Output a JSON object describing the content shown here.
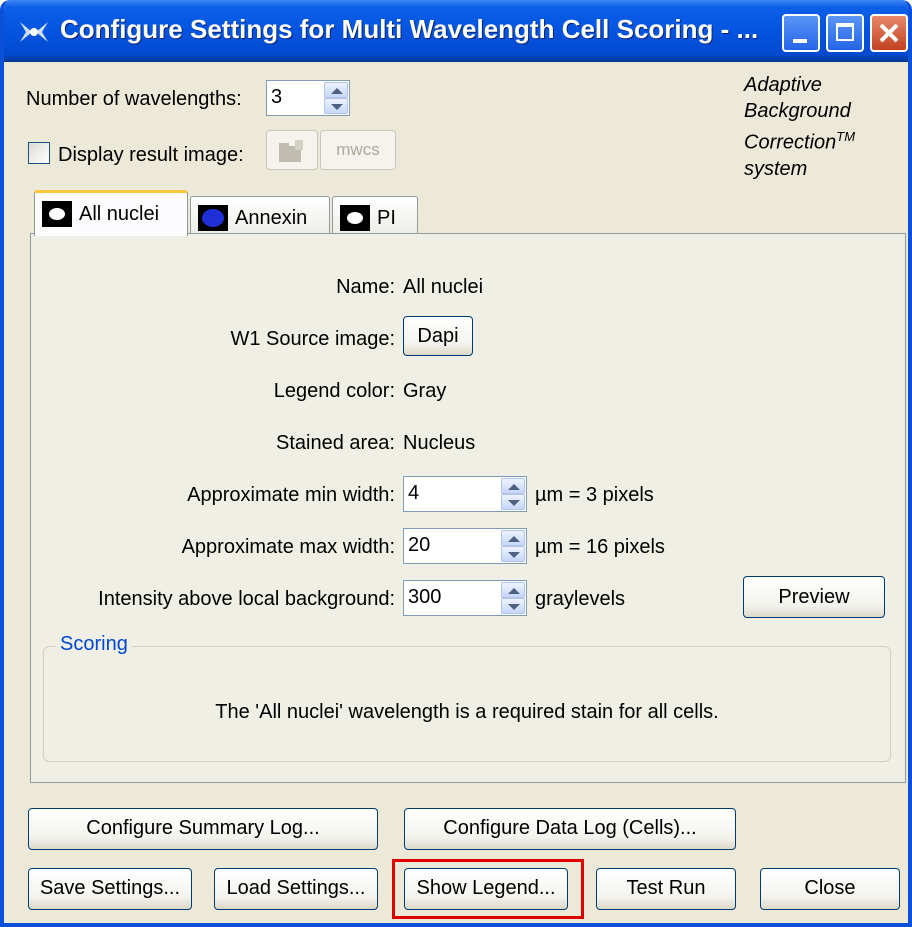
{
  "window": {
    "title": "Configure Settings for Multi Wavelength Cell Scoring - ...",
    "colors": {
      "titlebar": "#0454e0",
      "face": "#ece9d8",
      "close": "#c1421f"
    }
  },
  "top": {
    "num_wavelengths_label": "Number of wavelengths:",
    "num_wavelengths_value": "3",
    "display_result_label": "Display result image:",
    "display_result_checked": false,
    "mwcs_button": "mwcs"
  },
  "branding": {
    "line1": "Adaptive",
    "line2": "Background",
    "line3": "Correction",
    "tm": "TM",
    "line4": "system"
  },
  "tabs": [
    {
      "label": "All nuclei",
      "swatch": "#ffffff",
      "active": true
    },
    {
      "label": "Annexin",
      "swatch": "#1e2fd8",
      "active": false
    },
    {
      "label": "PI",
      "swatch": "#ffffff",
      "active": false
    }
  ],
  "form": {
    "name_label": "Name:",
    "name_value": "All nuclei",
    "source_label": "W1 Source image:",
    "source_value": "Dapi",
    "legend_label": "Legend color:",
    "legend_value": "Gray",
    "stained_label": "Stained area:",
    "stained_value": "Nucleus",
    "min_label": "Approximate min width:",
    "min_value": "4",
    "min_suffix": "µm = 3 pixels",
    "max_label": "Approximate max width:",
    "max_value": "20",
    "max_suffix": "µm = 16 pixels",
    "intensity_label": "Intensity above local background:",
    "intensity_value": "300",
    "intensity_suffix": "graylevels",
    "preview_button": "Preview"
  },
  "scoring": {
    "title": "Scoring",
    "message": "The 'All nuclei' wavelength is a required stain for all cells."
  },
  "buttons": {
    "summary_log": "Configure Summary Log...",
    "data_log": "Configure Data Log (Cells)...",
    "save": "Save Settings...",
    "load": "Load Settings...",
    "legend": "Show Legend...",
    "test": "Test Run",
    "close": "Close"
  }
}
